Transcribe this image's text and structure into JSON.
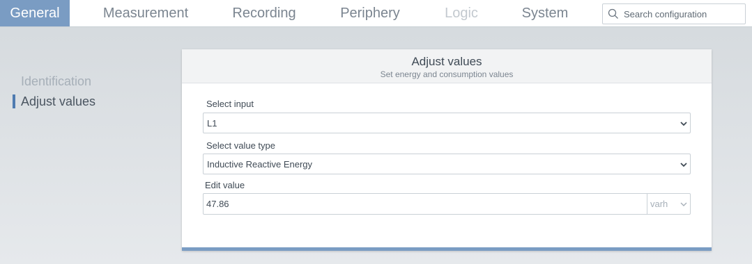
{
  "tabs": [
    {
      "label": "General",
      "state": "active"
    },
    {
      "label": "Measurement",
      "state": "normal"
    },
    {
      "label": "Recording",
      "state": "normal"
    },
    {
      "label": "Periphery",
      "state": "normal"
    },
    {
      "label": "Logic",
      "state": "disabled"
    },
    {
      "label": "System",
      "state": "normal"
    }
  ],
  "search": {
    "placeholder": "Search configuration",
    "icon": "search-icon"
  },
  "sidebar": {
    "items": [
      {
        "label": "Identification",
        "active": false
      },
      {
        "label": "Adjust values",
        "active": true
      }
    ]
  },
  "card": {
    "title": "Adjust values",
    "subtitle": "Set energy and consumption values",
    "input_select": {
      "label": "Select input",
      "value": "L1"
    },
    "type_select": {
      "label": "Select value type",
      "value": "Inductive Reactive Energy"
    },
    "edit_value": {
      "label": "Edit value",
      "value": "47.86",
      "unit": "varh"
    }
  },
  "colors": {
    "accent": "#7a9cc3",
    "active_marker": "#4f7bb0"
  }
}
